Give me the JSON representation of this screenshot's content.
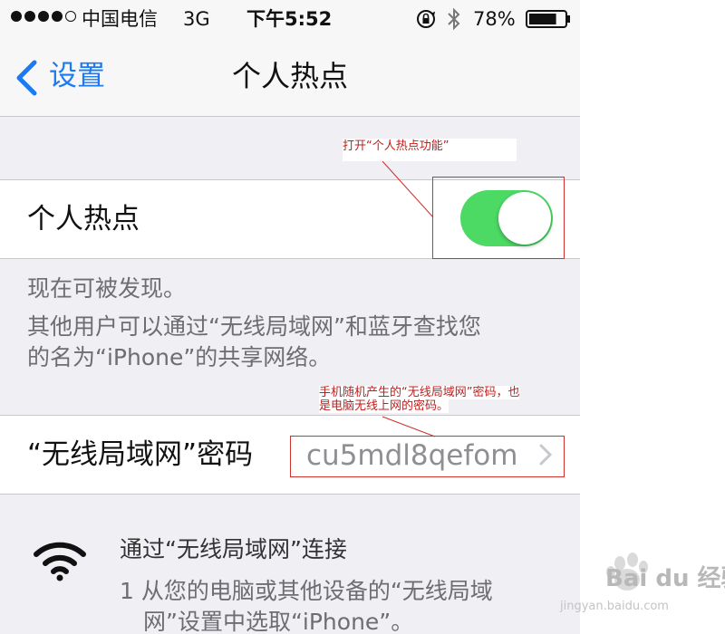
{
  "status_bar": {
    "signal_dots_filled": 4,
    "signal_dots_total": 5,
    "carrier": "中国电信",
    "network": "3G",
    "time": "下午5:52",
    "battery_percent": "78%",
    "battery_level": 0.78,
    "icons": [
      "rotation-lock-icon",
      "bluetooth-icon",
      "battery-icon"
    ]
  },
  "nav": {
    "back_label": "设置",
    "title": "个人热点"
  },
  "hotspot": {
    "label": "个人热点",
    "enabled": true,
    "toggle_color": "#4cd964"
  },
  "footer": {
    "discoverable": "现在可被发现。",
    "info_line1": "其他用户可以通过“无线局域网”和蓝牙查找您",
    "info_line2": "的名为“iPhone”的共享网络。"
  },
  "wifi_password": {
    "label": "“无线局域网”密码",
    "value": "cu5mdl8qefom"
  },
  "instructions": {
    "heading": "通过“无线局域网”连接",
    "step_line1": "1 从您的电脑或其他设备的“无线局域",
    "step_line2": "网”设置中选取“iPhone”。"
  },
  "annotations": {
    "toggle_note": "打开“个人热点功能”",
    "password_note_line1": "手机随机产生的“无线局域网”密码，也",
    "password_note_line2": "是电脑无线上网的密码。",
    "color": "#d0302e"
  },
  "watermark": {
    "brand": "Bai du",
    "product": "经验",
    "url": "jingyan.baidu.com"
  }
}
